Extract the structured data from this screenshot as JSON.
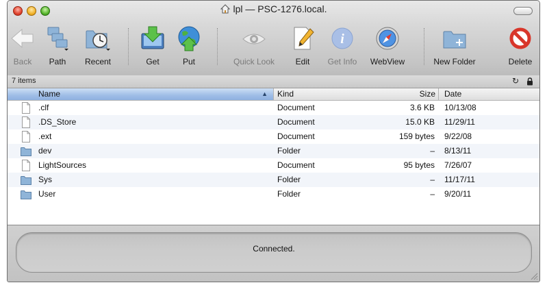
{
  "window": {
    "title": "lpl — PSC-1276.local."
  },
  "toolbar": {
    "back": "Back",
    "path": "Path",
    "recent": "Recent",
    "get": "Get",
    "put": "Put",
    "quick_look": "Quick Look",
    "edit": "Edit",
    "get_info": "Get Info",
    "webview": "WebView",
    "new_folder": "New Folder",
    "delete": "Delete"
  },
  "status_bar": {
    "items_count": "7 items"
  },
  "table": {
    "columns": {
      "name": "Name",
      "kind": "Kind",
      "size": "Size",
      "date": "Date"
    },
    "sort": {
      "column": "name",
      "direction": "ascending"
    },
    "rows": [
      {
        "name": ".clf",
        "kind": "Document",
        "size": "3.6 KB",
        "date": "10/13/08",
        "icon": "document-icon"
      },
      {
        "name": ".DS_Store",
        "kind": "Document",
        "size": "15.0 KB",
        "date": "11/29/11",
        "icon": "document-icon"
      },
      {
        "name": ".ext",
        "kind": "Document",
        "size": "159 bytes",
        "date": "9/22/08",
        "icon": "document-icon"
      },
      {
        "name": "dev",
        "kind": "Folder",
        "size": "–",
        "date": "8/13/11",
        "icon": "folder-icon"
      },
      {
        "name": "LightSources",
        "kind": "Document",
        "size": "95 bytes",
        "date": "7/26/07",
        "icon": "document-icon"
      },
      {
        "name": "Sys",
        "kind": "Folder",
        "size": "–",
        "date": "11/17/11",
        "icon": "folder-icon"
      },
      {
        "name": "User",
        "kind": "Folder",
        "size": "–",
        "date": "9/20/11",
        "icon": "folder-icon"
      }
    ]
  },
  "connection": {
    "status": "Connected."
  },
  "colors": {
    "sorted_header": "#9fbde6",
    "alt_row": "#f2f5fa",
    "folder": "#7fa6cc",
    "delete_red": "#d8362a"
  }
}
